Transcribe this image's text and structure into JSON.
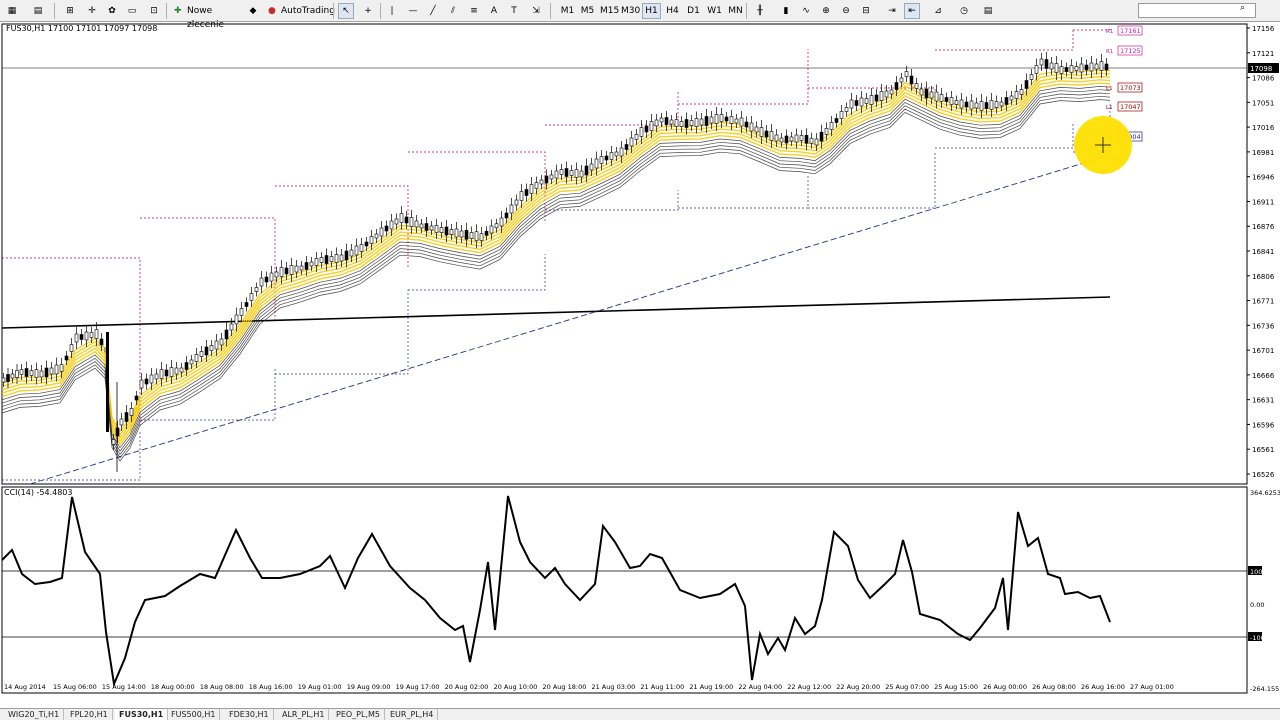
{
  "toolbar": {
    "new_order_label": "Nowe zlecenie",
    "autotrading_label": "AutoTrading",
    "timeframes": [
      "M1",
      "M5",
      "M15",
      "M30",
      "H1",
      "H4",
      "D1",
      "W1",
      "MN"
    ],
    "active_timeframe": "H1"
  },
  "chart": {
    "header": "FUS30,H1  17100 17101 17097 17098",
    "price_ticks": [
      "17156",
      "17121",
      "17086",
      "17051",
      "17016",
      "16981",
      "16946",
      "16911",
      "16876",
      "16841",
      "16806",
      "16771",
      "16736",
      "16701",
      "16666",
      "16631",
      "16596",
      "16561",
      "16526"
    ],
    "current_price": "17098",
    "level_labels": [
      {
        "tag": "R1",
        "value": "17161"
      },
      {
        "tag": "R1",
        "value": "17125"
      },
      {
        "tag": "L1",
        "value": "17073"
      },
      {
        "tag": "L1",
        "value": "17047"
      },
      {
        "tag": "L2",
        "value": "17004"
      }
    ],
    "time_ticks": [
      "14 Aug 2014",
      "15 Aug 06:00",
      "15 Aug 14:00",
      "18 Aug 00:00",
      "18 Aug 08:00",
      "18 Aug 16:00",
      "19 Aug 01:00",
      "19 Aug 09:00",
      "19 Aug 17:00",
      "20 Aug 02:00",
      "20 Aug 10:00",
      "20 Aug 18:00",
      "21 Aug 03:00",
      "21 Aug 11:00",
      "21 Aug 19:00",
      "22 Aug 04:00",
      "22 Aug 12:00",
      "22 Aug 20:00",
      "25 Aug 07:00",
      "25 Aug 15:00",
      "26 Aug 00:00",
      "26 Aug 08:00",
      "26 Aug 16:00",
      "27 Aug 01:00"
    ]
  },
  "indicator": {
    "label": "CCI(14) -54.4803",
    "ticks": [
      "364.6253",
      "100",
      "0.00",
      "-100",
      "-264.155"
    ]
  },
  "tabs": [
    "WIG20_Ti,H1",
    "FPL20,H1",
    "FUS30,H1",
    "FUS500,H1",
    "FDE30,H1",
    "ALR_PL,H1",
    "PEO_PL,M5",
    "EUR_PL,H4"
  ],
  "active_tab": "FUS30,H1",
  "colors": {
    "ribbon": "#f5c800",
    "bear_level": "#c00040",
    "bull_level": "#3030a0",
    "highlight": "#ffe000"
  }
}
